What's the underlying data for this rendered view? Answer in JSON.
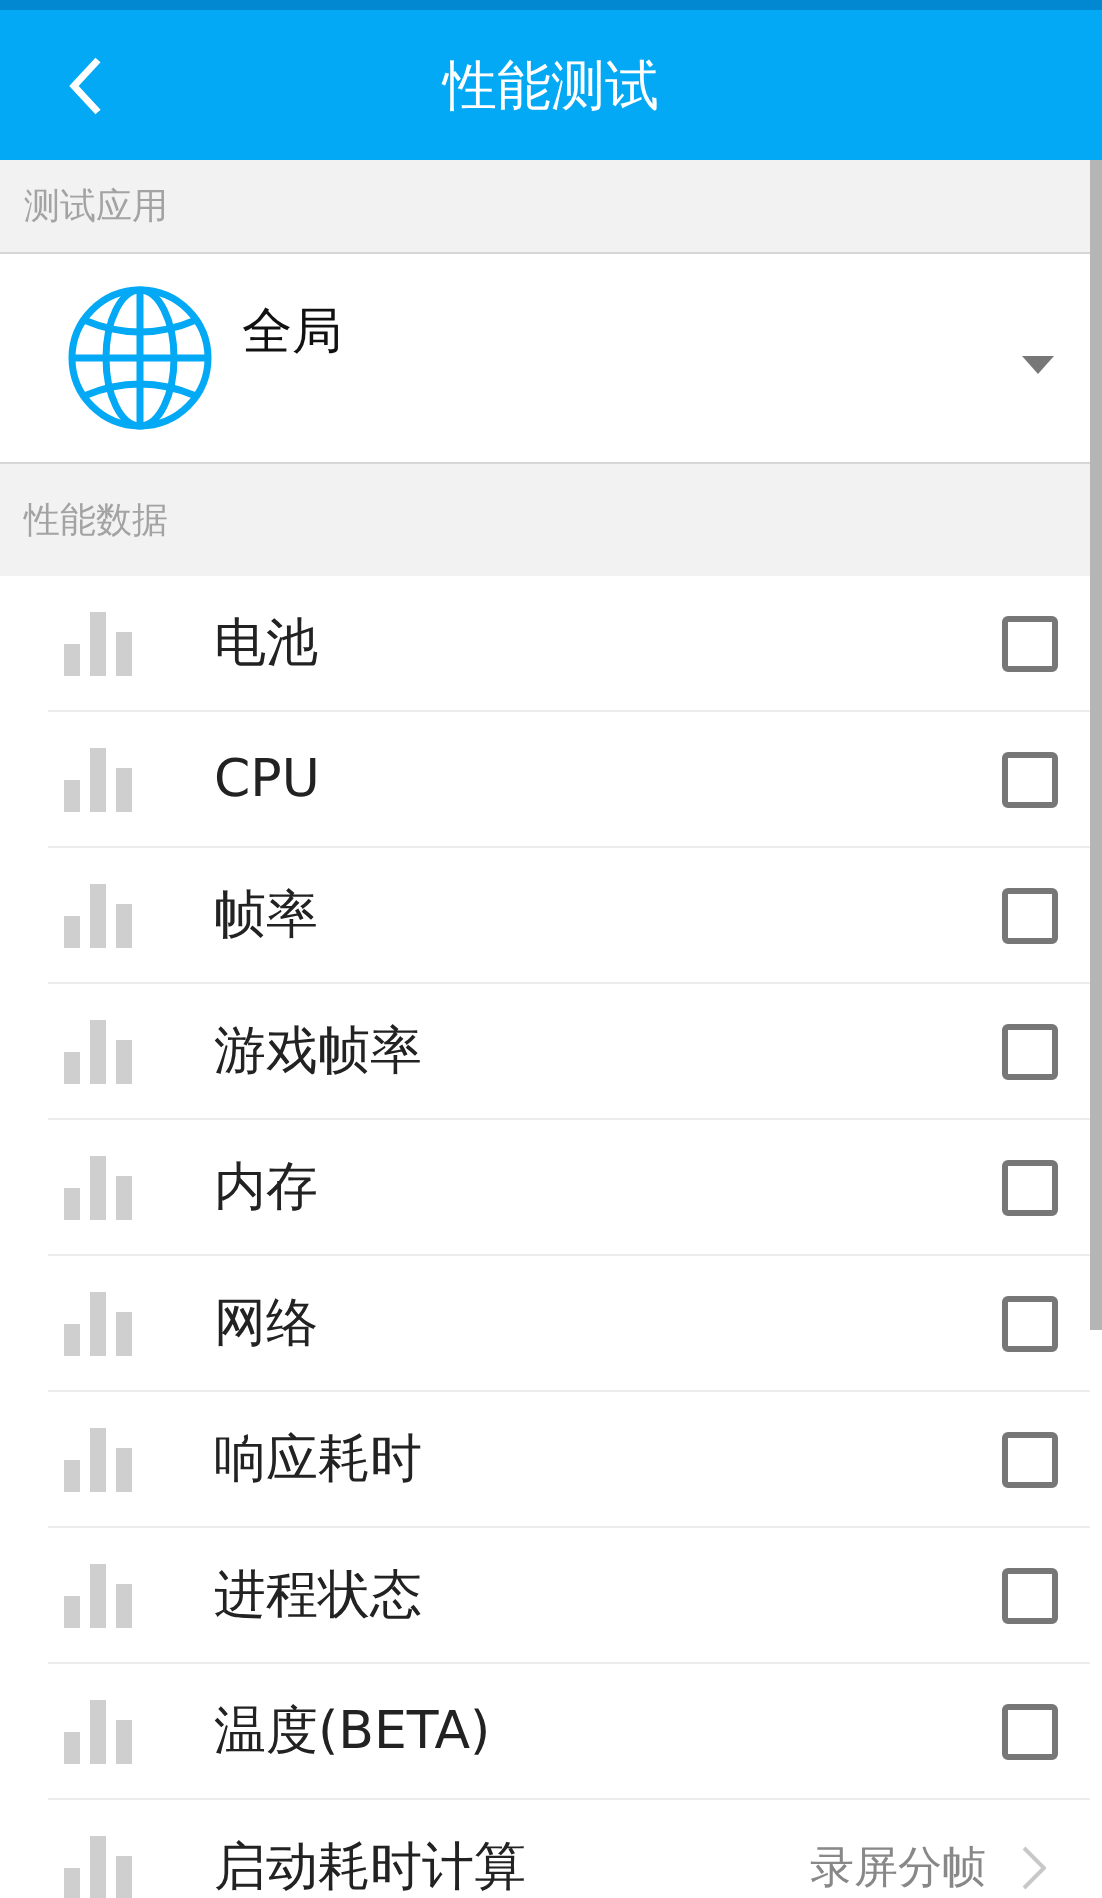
{
  "header": {
    "title": "性能测试"
  },
  "app_section": {
    "title": "测试应用",
    "app": {
      "name": "全局"
    }
  },
  "data_section": {
    "title": "性能数据",
    "items": [
      {
        "kind": "checkbox",
        "label": "电池",
        "checked": false
      },
      {
        "kind": "checkbox",
        "label": "CPU",
        "checked": false
      },
      {
        "kind": "checkbox",
        "label": "帧率",
        "checked": false
      },
      {
        "kind": "checkbox",
        "label": "游戏帧率",
        "checked": false
      },
      {
        "kind": "checkbox",
        "label": "内存",
        "checked": false
      },
      {
        "kind": "checkbox",
        "label": "网络",
        "checked": false
      },
      {
        "kind": "checkbox",
        "label": "响应耗时",
        "checked": false
      },
      {
        "kind": "checkbox",
        "label": "进程状态",
        "checked": false
      },
      {
        "kind": "checkbox",
        "label": "温度(BETA)",
        "checked": false
      },
      {
        "kind": "link",
        "label": "启动耗时计算",
        "value": "录屏分帧"
      }
    ]
  }
}
